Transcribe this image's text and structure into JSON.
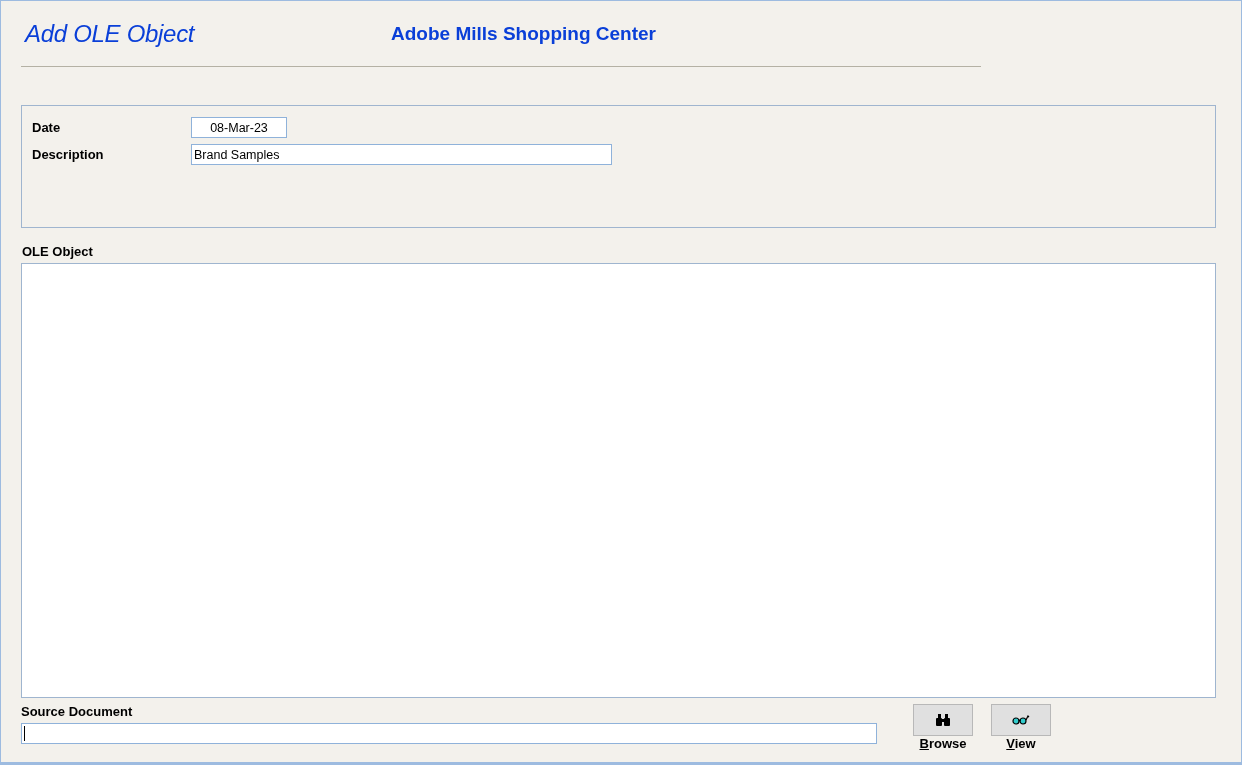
{
  "header": {
    "title": "Add OLE Object",
    "subtitle": "Adobe Mills Shopping Center"
  },
  "fields": [
    {
      "label": "Date",
      "value": "08-Mar-23",
      "kind": "short"
    },
    {
      "label": "Description",
      "value": "Brand Samples",
      "kind": "long"
    }
  ],
  "ole_object": {
    "label": "OLE Object"
  },
  "source_document": {
    "label": "Source Document",
    "focused": true
  },
  "buttons": [
    {
      "label": "Browse",
      "kind": "browse"
    },
    {
      "label": "View",
      "kind": "view"
    }
  ]
}
